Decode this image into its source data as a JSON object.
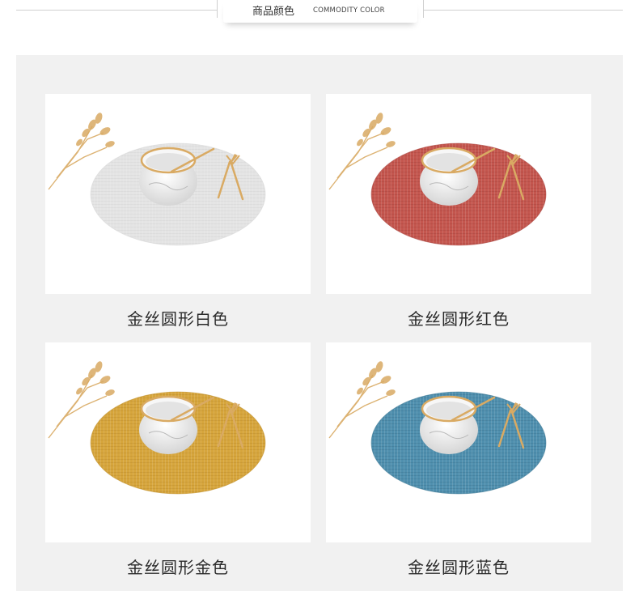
{
  "header": {
    "title_cn": "商品颜色",
    "title_en": "COMMODITY COLOR"
  },
  "products": [
    {
      "label": "金丝圆形白色",
      "mat_color": "#e4e4e4",
      "mat_shade": "#d4d4d4"
    },
    {
      "label": "金丝圆形红色",
      "mat_color": "#c4564e",
      "mat_shade": "#a9433d"
    },
    {
      "label": "金丝圆形金色",
      "mat_color": "#d6a53c",
      "mat_shade": "#c08f2b"
    },
    {
      "label": "金丝圆形蓝色",
      "mat_color": "#4f8fae",
      "mat_shade": "#3d7893"
    }
  ],
  "colors": {
    "panel_bg": "#f1f1f1",
    "gold": "#d9aa63",
    "bowl": "#f3f3f3"
  }
}
